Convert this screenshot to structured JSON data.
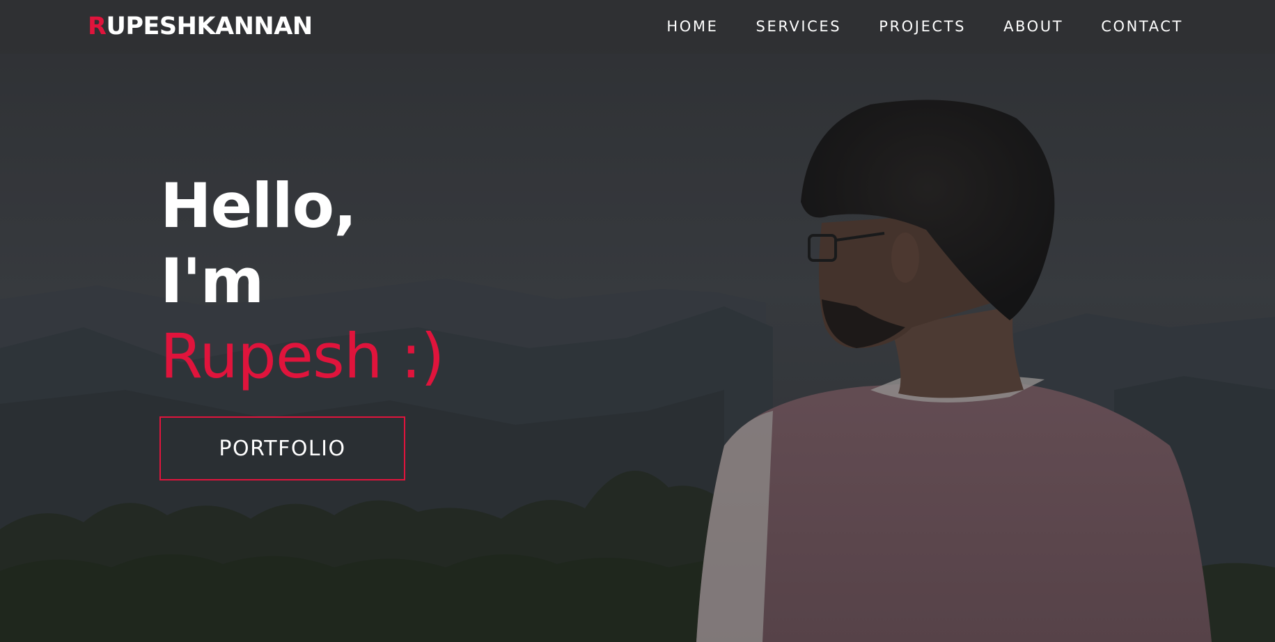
{
  "brand": {
    "logo_first": "R",
    "logo_rest": "UPESHKANNAN",
    "accent_color": "#e0143c"
  },
  "nav": {
    "items": [
      {
        "label": "HOME"
      },
      {
        "label": "SERVICES"
      },
      {
        "label": "PROJECTS"
      },
      {
        "label": "ABOUT"
      },
      {
        "label": "CONTACT"
      }
    ]
  },
  "hero": {
    "greeting": "Hello,",
    "intro": "I'm",
    "name": "Rupesh :)",
    "cta_label": "PORTFOLIO"
  }
}
